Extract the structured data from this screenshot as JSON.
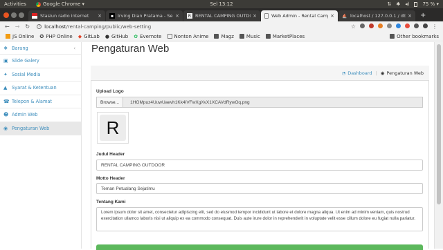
{
  "os": {
    "activities": "Activities",
    "app_name": "Google Chrome ▾",
    "clock": "Sel 13:12",
    "battery": "75 % ▾"
  },
  "tabs": [
    {
      "title": "Stasiun radio internet",
      "active": false
    },
    {
      "title": "Irving Dian Pratama - Sem",
      "active": false
    },
    {
      "title": "RENTAL CAMPING OUTDO",
      "active": false
    },
    {
      "title": "Web Admin - Rental Camp",
      "active": true
    },
    {
      "title": "localhost / 127.0.0.1 / db",
      "active": false
    }
  ],
  "address": {
    "host": "localhost",
    "path": "/rental-camping/public/web-setting"
  },
  "bookmarks": {
    "items": [
      "JS Online",
      "PHP Online",
      "GitLab",
      "GitHub",
      "Evernote",
      "Nonton Anime",
      "Magz",
      "Music",
      "MarketPlaces"
    ],
    "other": "Other bookmarks"
  },
  "sidebar": {
    "items": [
      {
        "label": "Barang",
        "icon": "cubes-icon",
        "has_chevron": true
      },
      {
        "label": "Slide Galery",
        "icon": "image-icon"
      },
      {
        "label": "Sosial Media",
        "icon": "twitter-icon"
      },
      {
        "label": "Syarat & Ketentuan",
        "icon": "warning-icon"
      },
      {
        "label": "Telepon & Alamat",
        "icon": "phone-icon"
      },
      {
        "label": "Admin Web",
        "icon": "users-icon"
      },
      {
        "label": "Pengaturan Web",
        "icon": "globe-icon",
        "active": true
      }
    ]
  },
  "page": {
    "title": "Pengaturan Web",
    "breadcrumb": {
      "home": "Dashboard",
      "current": "Pengaturan Web"
    },
    "form": {
      "logo_label": "Upload Logo",
      "browse_label": "Browse...",
      "file_name": "1HGMpuz4UuwUaevh1Kk4IVFwXgXvX1XCAVdRywOq.png",
      "logo_letter": "R",
      "header_label": "Judul Header",
      "header_value": "RENTAL CAMPING OUTDOOR",
      "motto_label": "Motto Header",
      "motto_value": "Teman Petualang Sejatimu",
      "about_label": "Tentang Kami",
      "about_value": "Lorem ipsum dolor sit amet, consectetur adipiscing elit, sed do eiusmod tempor incididunt ut labore et dolore magna aliqua. Ut enim ad minim veniam, quis nostrud exercitation ullamco laboris nisi ut aliquip ex ea commodo consequat. Duis aute irure dolor in reprehenderit in voluptate velit esse cillum dolore eu fugiat nulla pariatur."
    }
  },
  "colors": {
    "link": "#3c8dbc",
    "save_button": "#5cb85c",
    "topbar": "#3c3b37"
  }
}
